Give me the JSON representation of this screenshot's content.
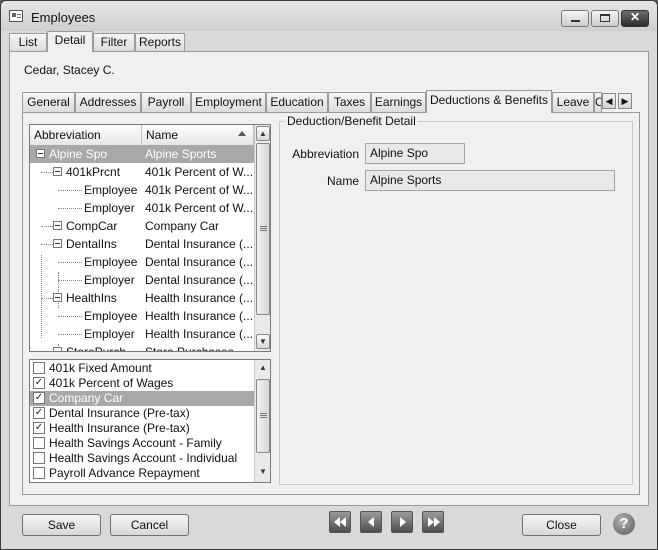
{
  "window": {
    "title": "Employees"
  },
  "top_tabs": [
    {
      "label": "List"
    },
    {
      "label": "Detail"
    },
    {
      "label": "Filter"
    },
    {
      "label": "Reports"
    }
  ],
  "employee_name": "Cedar, Stacey C.",
  "sub_tabs": [
    {
      "label": "General"
    },
    {
      "label": "Addresses"
    },
    {
      "label": "Payroll"
    },
    {
      "label": "Employment"
    },
    {
      "label": "Education"
    },
    {
      "label": "Taxes"
    },
    {
      "label": "Earnings"
    },
    {
      "label": "Deductions & Benefits"
    },
    {
      "label": "Leave"
    },
    {
      "label": "C"
    }
  ],
  "tree": {
    "headers": {
      "abbreviation": "Abbreviation",
      "name": "Name"
    },
    "rows": [
      {
        "abbr": "Alpine Spo",
        "name": "Alpine Sports"
      },
      {
        "abbr": "401kPrcnt",
        "name": "401k Percent of W..."
      },
      {
        "abbr": "Employee",
        "name": "401k Percent of W..."
      },
      {
        "abbr": "Employer",
        "name": "401k Percent of W..."
      },
      {
        "abbr": "CompCar",
        "name": "Company Car"
      },
      {
        "abbr": "DentalIns",
        "name": "Dental Insurance (..."
      },
      {
        "abbr": "Employee",
        "name": "Dental Insurance (..."
      },
      {
        "abbr": "Employer",
        "name": "Dental Insurance (..."
      },
      {
        "abbr": "HealthIns",
        "name": "Health Insurance (..."
      },
      {
        "abbr": "Employee",
        "name": "Health Insurance (..."
      },
      {
        "abbr": "Employer",
        "name": "Health Insurance (..."
      },
      {
        "abbr": "StorePurch",
        "name": "Store Purchases"
      }
    ]
  },
  "checklist": [
    {
      "label": "401k Fixed Amount",
      "checked": ""
    },
    {
      "label": "401k Percent of Wages",
      "checked": "✓"
    },
    {
      "label": "Company Car",
      "checked": "✓"
    },
    {
      "label": "Dental Insurance (Pre-tax)",
      "checked": "✓"
    },
    {
      "label": "Health Insurance (Pre-tax)",
      "checked": "✓"
    },
    {
      "label": "Health Savings Account - Family",
      "checked": ""
    },
    {
      "label": "Health Savings Account - Individual",
      "checked": ""
    },
    {
      "label": "Payroll Advance Repayment",
      "checked": ""
    }
  ],
  "detail": {
    "group_title": "Deduction/Benefit Detail",
    "abbreviation_label": "Abbreviation",
    "abbreviation_value": "Alpine Spo",
    "name_label": "Name",
    "name_value": "Alpine Sports"
  },
  "buttons": {
    "save": "Save",
    "cancel": "Cancel",
    "close": "Close",
    "help": "?"
  }
}
